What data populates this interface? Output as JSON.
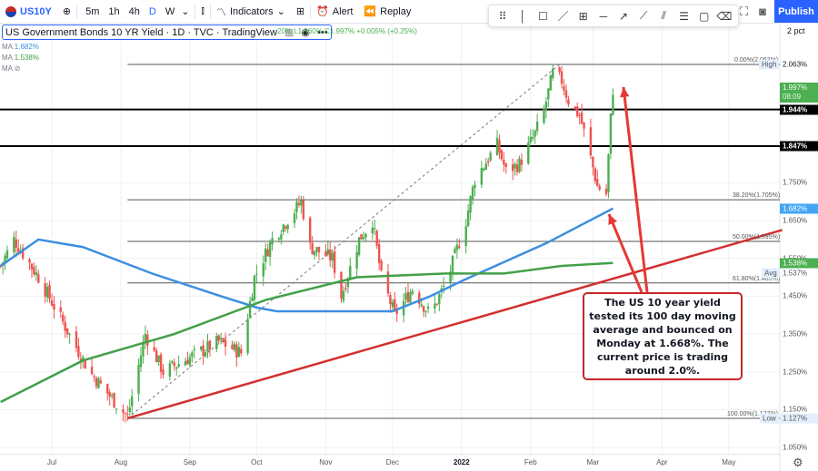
{
  "toolbar": {
    "symbol": "US10Y",
    "intervals": [
      "5m",
      "1h",
      "4h",
      "D",
      "W"
    ],
    "active_interval": "D",
    "indicators": "Indicators",
    "alert": "Alert",
    "replay": "Replay",
    "publish": "Publish"
  },
  "legend": {
    "title": "US Government Bonds 10 YR Yield · 1D · TVC · TradingView",
    "ohlc": "20% L1.960% C1.997% +0.005% (+0.25%)",
    "ma1_label": "MA",
    "ma1_value": "1.682%",
    "ma2_label": "MA",
    "ma2_value": "1.538%",
    "ma3_label": "MA"
  },
  "scale_mode": "2 pct",
  "colors": {
    "up": "#4caf50",
    "down": "#ef5350",
    "ma100": "#3d8ee0",
    "ma200": "#43a047",
    "trend": "#d32f2f",
    "accent": "#2962ff"
  },
  "annotation": "The US 10 year yield tested its  100 day moving average and bounced on Monday at 1.668%. The current price is trading around 2.0%.",
  "chart_data": {
    "type": "candlestick",
    "title": "US Government Bonds 10 YR Yield · 1D · TVC",
    "ylabel": "%",
    "ylim": [
      1.05,
      2.08
    ],
    "x_tick_labels": [
      {
        "label": "Jul",
        "date": "2021-07-01"
      },
      {
        "label": "Aug",
        "date": "2021-08-01"
      },
      {
        "label": "Sep",
        "date": "2021-09-01"
      },
      {
        "label": "Oct",
        "date": "2021-10-01"
      },
      {
        "label": "Nov",
        "date": "2021-11-01"
      },
      {
        "label": "Dec",
        "date": "2021-12-01"
      },
      {
        "label": "2022",
        "date": "2022-01-01"
      },
      {
        "label": "Feb",
        "date": "2022-02-01"
      },
      {
        "label": "Mar",
        "date": "2022-03-01"
      },
      {
        "label": "Apr",
        "date": "2022-04-01"
      },
      {
        "label": "May",
        "date": "2022-05-01"
      }
    ],
    "y_tick_labels": [
      "1.050%",
      "1.150%",
      "1.250%",
      "1.350%",
      "1.450%",
      "1.550%",
      "1.650%",
      "1.750%"
    ],
    "y_ticks": [
      1.05,
      1.15,
      1.25,
      1.35,
      1.45,
      1.55,
      1.65,
      1.75
    ],
    "close_path": [
      [
        "2021-06-08",
        1.53
      ],
      [
        "2021-06-14",
        1.6
      ],
      [
        "2021-06-25",
        1.5
      ],
      [
        "2021-07-18",
        1.25
      ],
      [
        "2021-08-04",
        1.13
      ],
      [
        "2021-08-12",
        1.35
      ],
      [
        "2021-08-20",
        1.25
      ],
      [
        "2021-09-14",
        1.33
      ],
      [
        "2021-09-24",
        1.3
      ],
      [
        "2021-09-30",
        1.5
      ],
      [
        "2021-10-08",
        1.6
      ],
      [
        "2021-10-21",
        1.7
      ],
      [
        "2021-10-25",
        1.58
      ],
      [
        "2021-11-04",
        1.55
      ],
      [
        "2021-11-08",
        1.45
      ],
      [
        "2021-11-16",
        1.6
      ],
      [
        "2021-11-22",
        1.65
      ],
      [
        "2021-11-26",
        1.5
      ],
      [
        "2021-12-02",
        1.4
      ],
      [
        "2021-12-10",
        1.47
      ],
      [
        "2021-12-18",
        1.4
      ],
      [
        "2021-12-26",
        1.5
      ],
      [
        "2022-01-03",
        1.65
      ],
      [
        "2022-01-07",
        1.76
      ],
      [
        "2022-01-17",
        1.85
      ],
      [
        "2022-01-21",
        1.78
      ],
      [
        "2022-01-27",
        1.8
      ],
      [
        "2022-02-03",
        1.88
      ],
      [
        "2022-02-07",
        1.94
      ],
      [
        "2022-02-11",
        2.04
      ],
      [
        "2022-02-15",
        2.02
      ],
      [
        "2022-02-19",
        1.95
      ],
      [
        "2022-02-23",
        1.93
      ],
      [
        "2022-02-27",
        1.84
      ],
      [
        "2022-03-03",
        1.74
      ],
      [
        "2022-03-07",
        1.72
      ],
      [
        "2022-03-09",
        1.92
      ],
      [
        "2022-03-10",
        1.997
      ]
    ],
    "ma100": [
      [
        "2021-06-08",
        1.53
      ],
      [
        "2021-06-25",
        1.6
      ],
      [
        "2021-07-15",
        1.58
      ],
      [
        "2021-08-15",
        1.51
      ],
      [
        "2021-09-15",
        1.45
      ],
      [
        "2021-10-01",
        1.42
      ],
      [
        "2021-10-10",
        1.41
      ],
      [
        "2021-12-01",
        1.41
      ],
      [
        "2021-12-18",
        1.45
      ],
      [
        "2022-01-01",
        1.49
      ],
      [
        "2022-02-08",
        1.59
      ],
      [
        "2022-03-10",
        1.682
      ]
    ],
    "ma200": [
      [
        "2021-06-08",
        1.17
      ],
      [
        "2021-07-15",
        1.28
      ],
      [
        "2021-08-25",
        1.35
      ],
      [
        "2021-10-05",
        1.44
      ],
      [
        "2021-11-15",
        1.5
      ],
      [
        "2021-12-25",
        1.51
      ],
      [
        "2022-01-20",
        1.51
      ],
      [
        "2022-02-15",
        1.53
      ],
      [
        "2022-03-10",
        1.538
      ]
    ],
    "trendline": [
      [
        "2021-08-04",
        1.127
      ],
      [
        "2022-05-25",
        1.625
      ]
    ],
    "fib_range": [
      [
        "2021-08-04",
        1.127
      ],
      [
        "2022-02-14",
        2.063
      ]
    ],
    "fib_levels": [
      {
        "label": "0.00%(2.063%)",
        "value": 2.063
      },
      {
        "label": "38.20%(1.705%)",
        "value": 1.705
      },
      {
        "label": "50.00%(1.595%)",
        "value": 1.595
      },
      {
        "label": "61.80%(1.485%)",
        "value": 1.485
      },
      {
        "label": "100.00%(1.127%)",
        "value": 1.127
      }
    ],
    "horizontal_lines": [
      {
        "label": "1.944%",
        "value": 1.944
      },
      {
        "label": "1.847%",
        "value": 1.847
      }
    ],
    "price_tags": {
      "high_label": "High",
      "high": "2.063%",
      "last": "1.997%",
      "countdown": "08:09",
      "line1": "1.944%",
      "line2": "1.847%",
      "ma100": "1.682%",
      "ma200": "1.538%",
      "avg_label": "Avg",
      "avg": "1.537%",
      "low_label": "Low",
      "low": "1.127%"
    },
    "legend_placement": "top-left"
  }
}
